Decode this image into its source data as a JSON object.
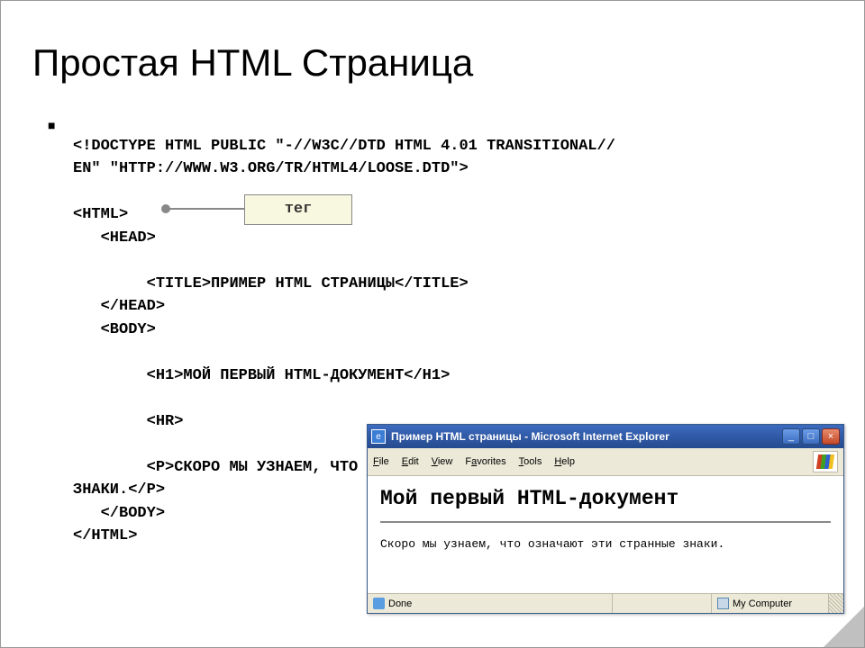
{
  "slide": {
    "title": "Простая HTML Страница",
    "callout": "тег",
    "code": {
      "doctype": "<!DOCTYPE HTML PUBLIC \"-//W3C//DTD HTML 4.01 TRANSITIONAL//\nEN\" \"HTTP://WWW.W3.ORG/TR/HTML4/LOOSE.DTD\">",
      "html_open": "<HTML>",
      "head_open": "<HEAD>",
      "title_tag": "<TITLE>ПРИМЕР HTML СТРАНИЦЫ</TITLE>",
      "head_close": "</HEAD>",
      "body_open": "<BODY>",
      "h1_tag": "<H1>МОЙ ПЕРВЫЙ HTML-ДОКУМЕНТ</H1>",
      "hr_tag": "<HR>",
      "p_tag": "<P>СКОРО МЫ УЗНАЕМ, ЧТО ОЗНАЧАЮТ ЭТИ СТРАННЫЕ\nЗНАКИ.</P>",
      "body_close": "</BODY>",
      "html_close": "</HTML>"
    }
  },
  "ie": {
    "title": "Пример HTML страницы - Microsoft Internet Explorer",
    "menu": {
      "file": "File",
      "edit": "Edit",
      "view": "View",
      "favorites": "Favorites",
      "tools": "Tools",
      "help": "Help"
    },
    "content": {
      "h1": "Мой первый HTML-документ",
      "p": "Скоро мы узнаем, что означают эти странные знаки."
    },
    "status": {
      "done": "Done",
      "zone": "My Computer"
    },
    "buttons": {
      "min": "_",
      "max": "□",
      "close": "×"
    }
  }
}
